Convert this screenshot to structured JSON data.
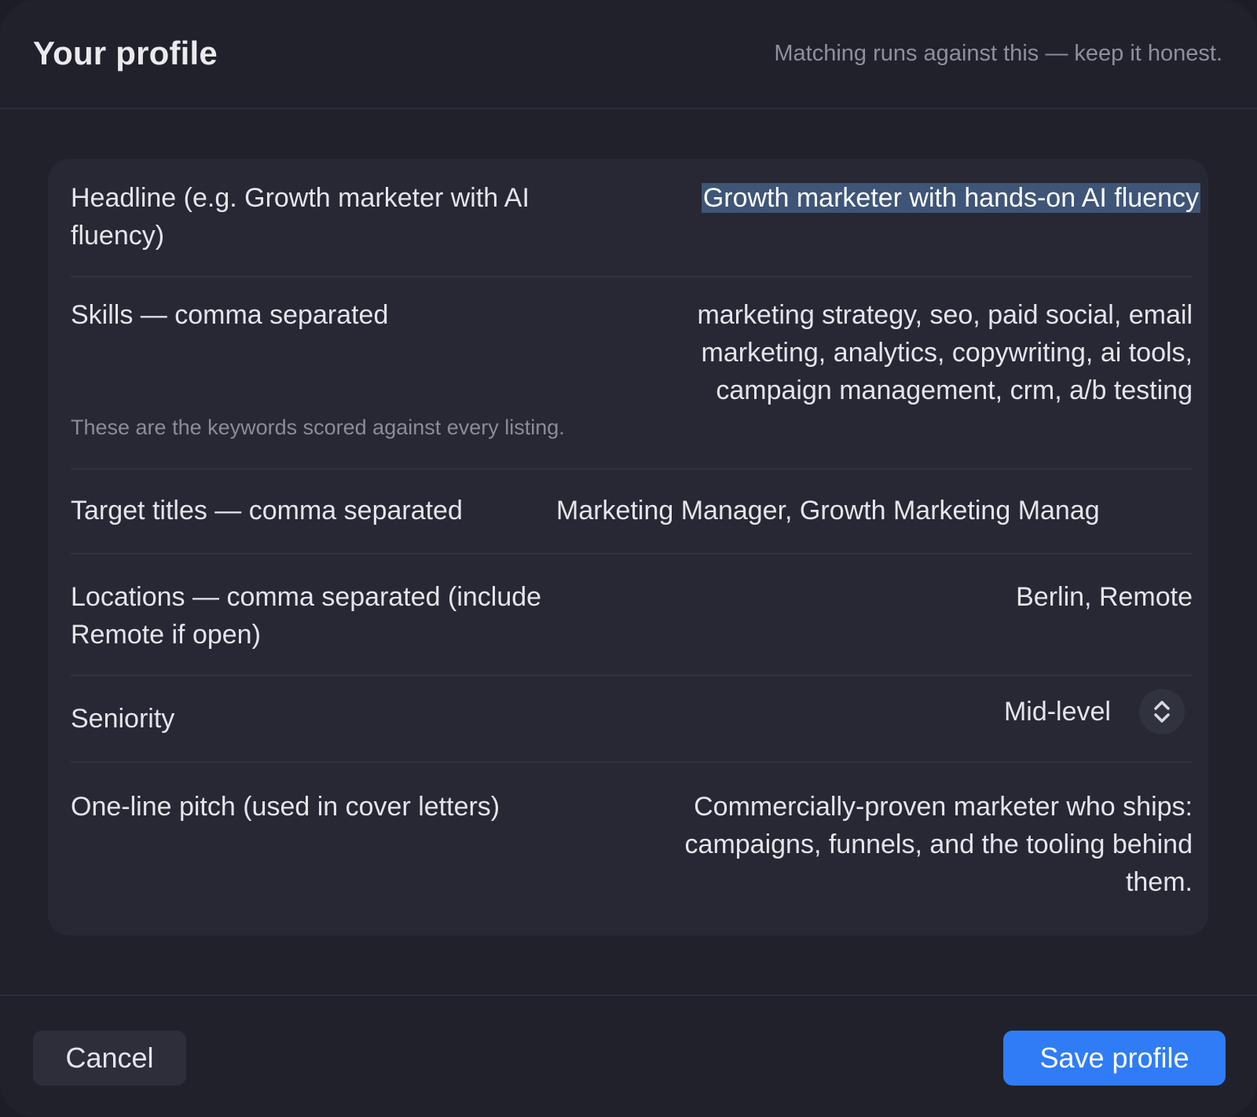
{
  "header": {
    "title": "Your profile",
    "subtitle": "Matching runs against this — keep it honest."
  },
  "fields": {
    "headline": {
      "label": "Headline (e.g. Growth marketer with AI fluency)",
      "value": "Growth marketer with hands-on AI fluency"
    },
    "skills": {
      "label": "Skills — comma separated",
      "value": "marketing strategy, seo, paid social, email marketing, analytics, copywriting, ai tools, campaign management, crm, a/b testing",
      "hint": "These are the keywords scored against every listing."
    },
    "target_titles": {
      "label": "Target titles — comma separated",
      "value": "Marketing Manager, Growth Marketing Manag"
    },
    "locations": {
      "label": "Locations — comma separated (include Remote if open)",
      "value": "Berlin, Remote"
    },
    "seniority": {
      "label": "Seniority",
      "value": "Mid-level",
      "icon": "chevron-up-down-icon"
    },
    "pitch": {
      "label": "One-line pitch (used in cover letters)",
      "value": "Commercially-proven marketer who ships: campaigns, funnels, and the tooling behind them."
    }
  },
  "footer": {
    "cancel_label": "Cancel",
    "save_label": "Save profile"
  },
  "colors": {
    "background": "#20212b",
    "card": "#272833",
    "accent": "#2f7cf6",
    "selection": "#3e5577"
  }
}
